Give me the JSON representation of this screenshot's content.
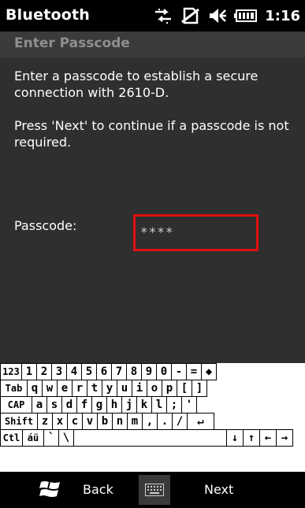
{
  "status": {
    "app_title": "Bluetooth",
    "time": "1:16",
    "icons": [
      "data-transfer-icon",
      "no-sim-icon",
      "volume-icon",
      "battery-icon"
    ]
  },
  "page": {
    "title": "Enter Passcode",
    "paragraph1": "Enter a passcode to establish a secure connection with 2610-D.",
    "paragraph2": "Press 'Next' to continue if a passcode is not required.",
    "passcode_label": "Passcode:",
    "passcode_value": "****"
  },
  "keyboard": {
    "rows": [
      [
        "123",
        "1",
        "2",
        "3",
        "4",
        "5",
        "6",
        "7",
        "8",
        "9",
        "0",
        "-",
        "=",
        "◆"
      ],
      [
        "Tab",
        "q",
        "w",
        "e",
        "r",
        "t",
        "y",
        "u",
        "i",
        "o",
        "p",
        "[",
        "]"
      ],
      [
        "CAP",
        "a",
        "s",
        "d",
        "f",
        "g",
        "h",
        "j",
        "k",
        "l",
        ";",
        "'"
      ],
      [
        "Shift",
        "z",
        "x",
        "c",
        "v",
        "b",
        "n",
        "m",
        ",",
        ".",
        "/",
        "↵"
      ],
      [
        "Ctl",
        "áü",
        "`",
        "\\",
        "",
        "↓",
        "↑",
        "←",
        "→"
      ]
    ]
  },
  "bottom": {
    "back_label": "Back",
    "next_label": "Next"
  },
  "colors": {
    "accent_border": "#e01010",
    "content_bg": "#2f2f2f",
    "header_bg": "#3b3b3b"
  }
}
